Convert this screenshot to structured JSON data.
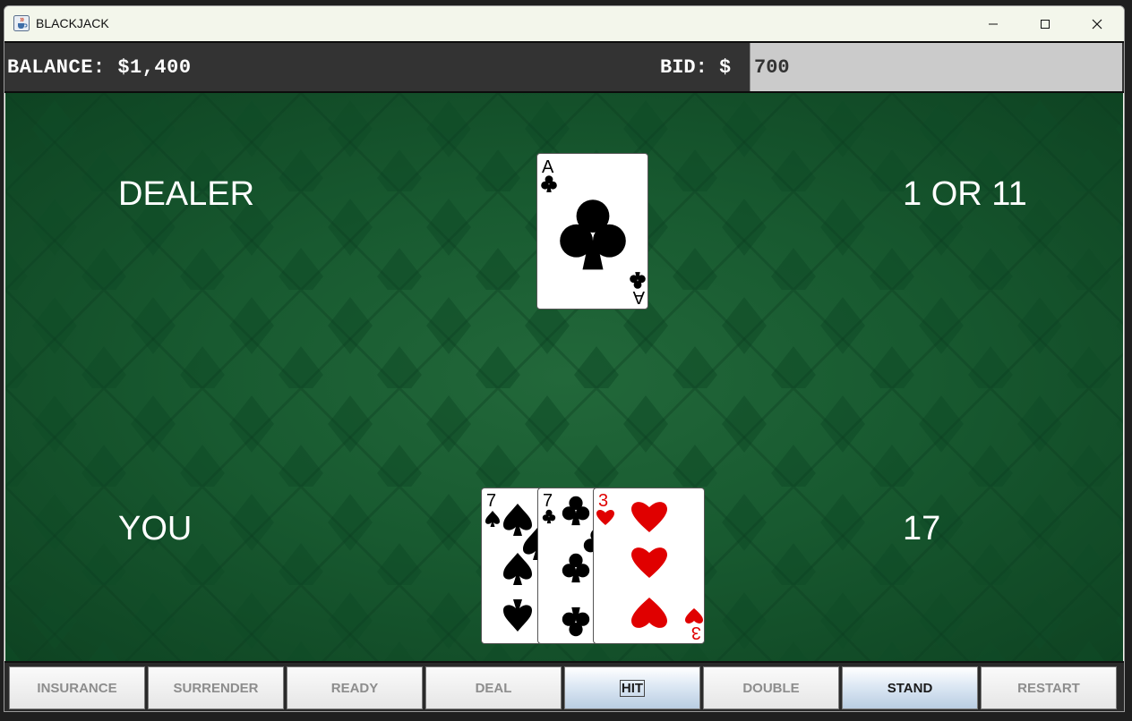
{
  "window": {
    "title": "BLACKJACK"
  },
  "header": {
    "balance_text": "BALANCE: $1,400",
    "bid_label": "BID: $",
    "bid_value": "700"
  },
  "dealer": {
    "label": "DEALER",
    "score": "1 OR 11",
    "cards": [
      {
        "rank": "A",
        "suit": "clubs"
      }
    ]
  },
  "player": {
    "label": "YOU",
    "score": "17",
    "cards": [
      {
        "rank": "7",
        "suit": "spades"
      },
      {
        "rank": "7",
        "suit": "clubs"
      },
      {
        "rank": "3",
        "suit": "hearts"
      }
    ]
  },
  "buttons": {
    "insurance": "INSURANCE",
    "surrender": "SURRENDER",
    "ready": "READY",
    "deal": "DEAL",
    "hit": "HIT",
    "double": "DOUBLE",
    "stand": "STAND",
    "restart": "RESTART"
  },
  "colors": {
    "felt": "#185a30",
    "topbar": "#333333",
    "red_suit": "#e00000"
  },
  "icons": {
    "app": "java-cup-icon",
    "minimize": "minimize-icon",
    "maximize": "maximize-icon",
    "close": "close-icon"
  }
}
